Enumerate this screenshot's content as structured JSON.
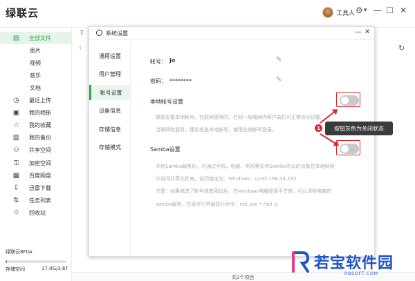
{
  "app": {
    "title": "绿联云",
    "user_name": "工具人"
  },
  "window_controls": {
    "settings": "⚙",
    "menu": "▾",
    "minimize": "—",
    "maximize": "☐",
    "close": "✕"
  },
  "sidebar": {
    "items": [
      {
        "label": "全部文件",
        "icon": "file-icon",
        "glyph": "▤",
        "active": true
      },
      {
        "label": "图片",
        "sub": true
      },
      {
        "label": "视频",
        "sub": true
      },
      {
        "label": "音乐",
        "sub": true
      },
      {
        "label": "文档",
        "sub": true
      },
      {
        "label": "最近上传",
        "icon": "clock-icon",
        "glyph": "◷"
      },
      {
        "label": "我的相册",
        "icon": "album-icon",
        "glyph": "▣"
      },
      {
        "label": "我的收藏",
        "icon": "star-icon",
        "glyph": "☆"
      },
      {
        "label": "我的备份",
        "icon": "backup-icon",
        "glyph": "▥"
      },
      {
        "label": "共享空间",
        "icon": "share-users-icon",
        "glyph": "⚇"
      },
      {
        "label": "加密空间",
        "icon": "lock-user-icon",
        "glyph": "⚿"
      },
      {
        "label": "百度网盘",
        "icon": "baidu-disk-icon",
        "glyph": "▦"
      },
      {
        "label": "迅雷下载",
        "icon": "download-icon",
        "glyph": "⇩"
      },
      {
        "label": "任务列表",
        "icon": "tasks-icon",
        "glyph": "⇅"
      },
      {
        "label": "回收站",
        "icon": "trash-icon",
        "glyph": "♲"
      }
    ],
    "device_name": "绿联云8F0A",
    "storage_label": "存储空间",
    "storage_value": "17.0G/3.6T",
    "storage_fraction": 0.005
  },
  "main": {
    "bottom_text": "共2个项目"
  },
  "dialog": {
    "title": "系统设置",
    "nav": [
      "通用设置",
      "用户管理",
      "帐号设置",
      "设备信息",
      "存储信息",
      "存储模式"
    ],
    "active_nav": 2,
    "account_label": "帐号：",
    "account_value": "jo",
    "password_label": "密码：",
    "password_value": "********",
    "local_section": "本地帐号设置",
    "local_desc": [
      "提前设置本地帐号，在联网受限时，在同一局域网内客户端仍可正常访问设备。",
      "当联网恢复时，建议退出本地帐号，使用在线帐号登录。"
    ],
    "samba_section": "Samba设置",
    "samba_desc": [
      "开启Samba服务后，可通过手机、电脑、电视等支持Samba协议的设备在本地网络",
      "中访问共享文件夹。访问地址为：Windows：\\\\192.168.44.192",
      "注意：如果修改了帐号或者密码后，在windows电脑登录不生效，可以清除电脑的",
      "samba缓存，在命令行界面执行命令：net use * /del /y"
    ],
    "local_toggle_on": false,
    "samba_toggle_on": false
  },
  "annotation": {
    "number": "1",
    "text": "按钮灰色为关闭状态",
    "color": "#e0262c"
  },
  "watermark": {
    "text": "若宝软件园",
    "sub": "RBSOFT.COM"
  },
  "colors": {
    "accent": "#2fa449",
    "annotation": "#e0262c",
    "watermark": "#1e55c9"
  }
}
